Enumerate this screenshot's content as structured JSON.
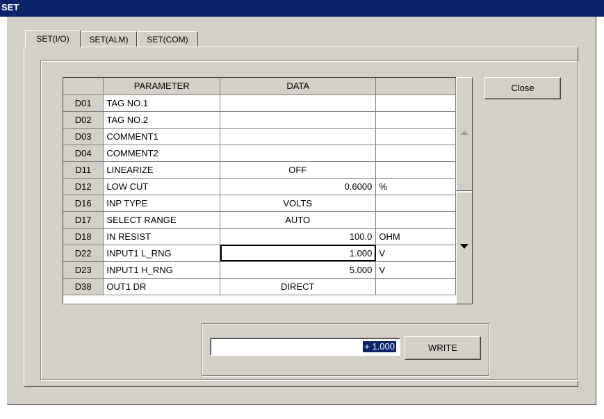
{
  "window": {
    "title": "SET"
  },
  "tabs": [
    {
      "label": "SET(I/O)"
    },
    {
      "label": "SET(ALM)"
    },
    {
      "label": "SET(COM)"
    }
  ],
  "grid": {
    "headers": [
      "",
      "PARAMETER",
      "DATA",
      ""
    ],
    "rows": [
      {
        "code": "D01",
        "param": "TAG NO.1",
        "data": "",
        "unit": ""
      },
      {
        "code": "D02",
        "param": "TAG NO.2",
        "data": "",
        "unit": ""
      },
      {
        "code": "D03",
        "param": "COMMENT1",
        "data": "",
        "unit": ""
      },
      {
        "code": "D04",
        "param": "COMMENT2",
        "data": "",
        "unit": ""
      },
      {
        "code": "D11",
        "param": "LINEARIZE",
        "data": "OFF",
        "unit": ""
      },
      {
        "code": "D12",
        "param": "LOW CUT",
        "data": "0.6000",
        "unit": "%"
      },
      {
        "code": "D16",
        "param": "INP TYPE",
        "data": "VOLTS",
        "unit": ""
      },
      {
        "code": "D17",
        "param": "SELECT RANGE",
        "data": "AUTO",
        "unit": ""
      },
      {
        "code": "D18",
        "param": "IN RESIST",
        "data": "100.0",
        "unit": "OHM"
      },
      {
        "code": "D22",
        "param": "INPUT1 L_RNG",
        "data": "1.000",
        "unit": "V"
      },
      {
        "code": "D23",
        "param": "INPUT1 H_RNG",
        "data": "5.000",
        "unit": "V"
      },
      {
        "code": "D38",
        "param": "OUT1 DR",
        "data": "DIRECT",
        "unit": ""
      }
    ]
  },
  "buttons": {
    "close": "Close",
    "write": "WRITE"
  },
  "input": {
    "value": "+ 1.000"
  }
}
